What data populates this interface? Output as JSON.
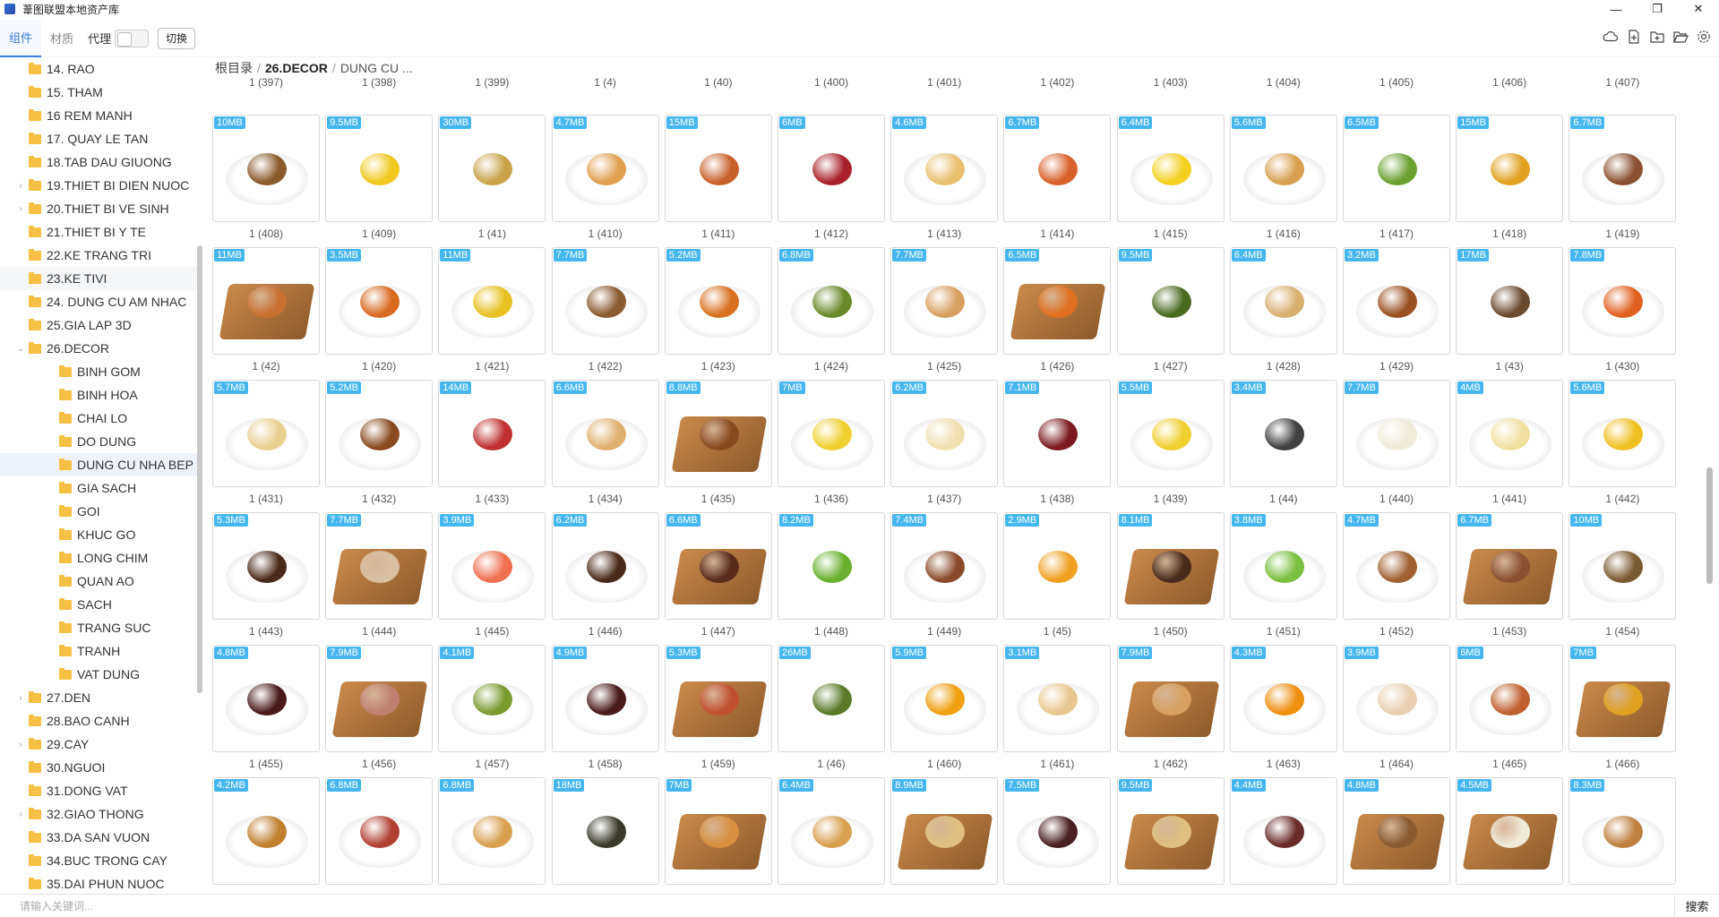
{
  "window": {
    "title": "葦图联盟本地资产库",
    "controls": [
      "—",
      "❐",
      "✕"
    ]
  },
  "toolbar": {
    "tabs": [
      {
        "label": "组件",
        "active": true
      },
      {
        "label": "材质",
        "active": false
      }
    ],
    "proxy_label": "代理",
    "switch_label": "切换",
    "icons": [
      "cloud-icon",
      "new-file-icon",
      "new-folder-icon",
      "open-folder-icon",
      "gear-icon"
    ]
  },
  "breadcrumb": {
    "root": "根目录",
    "folder": "26.DECOR",
    "current": "DUNG CU ..."
  },
  "sidebar": {
    "items": [
      {
        "label": "14. RAO",
        "indent": 0,
        "arrow": ""
      },
      {
        "label": "15. THAM",
        "indent": 0,
        "arrow": ""
      },
      {
        "label": "16 REM MANH",
        "indent": 0,
        "arrow": ""
      },
      {
        "label": "17. QUAY LE TAN",
        "indent": 0,
        "arrow": ""
      },
      {
        "label": "18.TAB DAU GIUONG",
        "indent": 0,
        "arrow": ""
      },
      {
        "label": "19.THIET BI DIEN NUOC",
        "indent": 0,
        "arrow": "›"
      },
      {
        "label": "20.THIET BI VE SINH",
        "indent": 0,
        "arrow": "›"
      },
      {
        "label": "21.THIET BI Y TE",
        "indent": 0,
        "arrow": ""
      },
      {
        "label": "22.KE TRANG TRI",
        "indent": 0,
        "arrow": ""
      },
      {
        "label": "23.KE TIVI",
        "indent": 0,
        "arrow": ""
      },
      {
        "label": "24. DUNG CU AM NHAC",
        "indent": 0,
        "arrow": ""
      },
      {
        "label": "25.GIA LAP 3D",
        "indent": 0,
        "arrow": ""
      },
      {
        "label": "26.DECOR",
        "indent": 0,
        "arrow": "⌄"
      },
      {
        "label": "BINH GOM",
        "indent": 1,
        "arrow": ""
      },
      {
        "label": "BINH HOA",
        "indent": 1,
        "arrow": ""
      },
      {
        "label": "CHAI LO",
        "indent": 1,
        "arrow": ""
      },
      {
        "label": "DO DUNG",
        "indent": 1,
        "arrow": ""
      },
      {
        "label": "DUNG CU NHA BEP",
        "indent": 1,
        "arrow": ""
      },
      {
        "label": "GIA SACH",
        "indent": 1,
        "arrow": ""
      },
      {
        "label": "GOI",
        "indent": 1,
        "arrow": ""
      },
      {
        "label": "KHUC GO",
        "indent": 1,
        "arrow": ""
      },
      {
        "label": "LONG CHIM",
        "indent": 1,
        "arrow": ""
      },
      {
        "label": "QUAN AO",
        "indent": 1,
        "arrow": ""
      },
      {
        "label": "SACH",
        "indent": 1,
        "arrow": ""
      },
      {
        "label": "TRANG SUC",
        "indent": 1,
        "arrow": ""
      },
      {
        "label": "TRANH",
        "indent": 1,
        "arrow": ""
      },
      {
        "label": "VAT DUNG",
        "indent": 1,
        "arrow": ""
      },
      {
        "label": "27.DEN",
        "indent": 0,
        "arrow": "›"
      },
      {
        "label": "28.BAO CANH",
        "indent": 0,
        "arrow": ""
      },
      {
        "label": "29.CAY",
        "indent": 0,
        "arrow": "›"
      },
      {
        "label": "30.NGUOI",
        "indent": 0,
        "arrow": ""
      },
      {
        "label": "31.DONG VAT",
        "indent": 0,
        "arrow": ""
      },
      {
        "label": "32.GIAO THONG",
        "indent": 0,
        "arrow": "›"
      },
      {
        "label": "33.DA SAN VUON",
        "indent": 0,
        "arrow": ""
      },
      {
        "label": "34.BUC TRONG CAY",
        "indent": 0,
        "arrow": ""
      },
      {
        "label": "35.DAI PHUN NUOC",
        "indent": 0,
        "arrow": ""
      }
    ],
    "selected": "DUNG CU NHA BEP",
    "hovered": "23.KE TIVI"
  },
  "assets_top_partial": [
    "1 (397)",
    "1 (398)",
    "1 (399)",
    "1 (4)",
    "1 (40)",
    "1 (400)",
    "1 (401)",
    "1 (402)",
    "1 (403)",
    "1 (404)",
    "1 (405)",
    "1 (406)",
    "1 (407)"
  ],
  "assets": [
    [
      {
        "size": "10MB",
        "name": "1 (408)",
        "style": "plate",
        "color": "#8b5a2b"
      },
      {
        "size": "9.5MB",
        "name": "1 (409)",
        "style": "none",
        "color": "#f0c81e"
      },
      {
        "size": "30MB",
        "name": "1 (41)",
        "style": "none",
        "color": "#c9a24a"
      },
      {
        "size": "4.7MB",
        "name": "1 (410)",
        "style": "plate",
        "color": "#e0a050"
      },
      {
        "size": "15MB",
        "name": "1 (411)",
        "style": "none",
        "color": "#c8602a"
      },
      {
        "size": "6MB",
        "name": "1 (412)",
        "style": "none",
        "color": "#a8202a"
      },
      {
        "size": "4.6MB",
        "name": "1 (413)",
        "style": "plate",
        "color": "#e8c070"
      },
      {
        "size": "6.7MB",
        "name": "1 (414)",
        "style": "none",
        "color": "#d8602a"
      },
      {
        "size": "6.4MB",
        "name": "1 (415)",
        "style": "plate",
        "color": "#f5d020"
      },
      {
        "size": "5.6MB",
        "name": "1 (416)",
        "style": "plate",
        "color": "#d8a050"
      },
      {
        "size": "6.5MB",
        "name": "1 (417)",
        "style": "none",
        "color": "#6aa030"
      },
      {
        "size": "15MB",
        "name": "1 (418)",
        "style": "none",
        "color": "#e0a020"
      },
      {
        "size": "6.7MB",
        "name": "1 (419)",
        "style": "plate",
        "color": "#8a5030"
      }
    ],
    [
      {
        "size": "11MB",
        "name": "1 (42)",
        "style": "board",
        "color": "#c87030"
      },
      {
        "size": "3.5MB",
        "name": "1 (420)",
        "style": "plate",
        "color": "#d86a20"
      },
      {
        "size": "11MB",
        "name": "1 (421)",
        "style": "plate",
        "color": "#e8c020"
      },
      {
        "size": "7.7MB",
        "name": "1 (422)",
        "style": "plate",
        "color": "#8a5a30"
      },
      {
        "size": "5.2MB",
        "name": "1 (423)",
        "style": "plate",
        "color": "#d87020"
      },
      {
        "size": "6.8MB",
        "name": "1 (424)",
        "style": "plate",
        "color": "#6a8a2a"
      },
      {
        "size": "7.7MB",
        "name": "1 (425)",
        "style": "plate",
        "color": "#d8a060"
      },
      {
        "size": "6.5MB",
        "name": "1 (426)",
        "style": "board",
        "color": "#e07020"
      },
      {
        "size": "9.5MB",
        "name": "1 (427)",
        "style": "none",
        "color": "#4a6a20"
      },
      {
        "size": "6.4MB",
        "name": "1 (428)",
        "style": "plate",
        "color": "#d8b070"
      },
      {
        "size": "3.2MB",
        "name": "1 (429)",
        "style": "plate",
        "color": "#9a5020"
      },
      {
        "size": "17MB",
        "name": "1 (43)",
        "style": "none",
        "color": "#6a4a30"
      },
      {
        "size": "7.8MB",
        "name": "1 (430)",
        "style": "plate",
        "color": "#e06020"
      }
    ],
    [
      {
        "size": "5.7MB",
        "name": "1 (431)",
        "style": "plate",
        "color": "#e8d090"
      },
      {
        "size": "5.2MB",
        "name": "1 (432)",
        "style": "plate",
        "color": "#8a4a20"
      },
      {
        "size": "14MB",
        "name": "1 (433)",
        "style": "none",
        "color": "#c03030"
      },
      {
        "size": "6.6MB",
        "name": "1 (434)",
        "style": "plate",
        "color": "#e0b070"
      },
      {
        "size": "8.8MB",
        "name": "1 (435)",
        "style": "board",
        "color": "#8a4a20"
      },
      {
        "size": "7MB",
        "name": "1 (436)",
        "style": "plate",
        "color": "#f0d030"
      },
      {
        "size": "6.2MB",
        "name": "1 (437)",
        "style": "plate",
        "color": "#f0e0b0"
      },
      {
        "size": "7.1MB",
        "name": "1 (438)",
        "style": "none",
        "color": "#7a1a20"
      },
      {
        "size": "5.5MB",
        "name": "1 (439)",
        "style": "plate",
        "color": "#f0d030"
      },
      {
        "size": "3.4MB",
        "name": "1 (44)",
        "style": "none",
        "color": "#404040"
      },
      {
        "size": "7.7MB",
        "name": "1 (440)",
        "style": "plate",
        "color": "#f0ead8"
      },
      {
        "size": "4MB",
        "name": "1 (441)",
        "style": "plate",
        "color": "#f0e0a0"
      },
      {
        "size": "5.6MB",
        "name": "1 (442)",
        "style": "plate",
        "color": "#f0c020"
      }
    ],
    [
      {
        "size": "5.3MB",
        "name": "1 (443)",
        "style": "plate",
        "color": "#4a2a1a"
      },
      {
        "size": "7.7MB",
        "name": "1 (444)",
        "style": "board",
        "color": "#d8c0a0"
      },
      {
        "size": "3.9MB",
        "name": "1 (445)",
        "style": "plate",
        "color": "#f07050"
      },
      {
        "size": "6.2MB",
        "name": "1 (446)",
        "style": "plate",
        "color": "#4a2a1a"
      },
      {
        "size": "6.6MB",
        "name": "1 (447)",
        "style": "board",
        "color": "#5a2a1a"
      },
      {
        "size": "8.2MB",
        "name": "1 (448)",
        "style": "none",
        "color": "#6ab030"
      },
      {
        "size": "7.4MB",
        "name": "1 (449)",
        "style": "plate",
        "color": "#8a4a2a"
      },
      {
        "size": "2.9MB",
        "name": "1 (45)",
        "style": "none",
        "color": "#f0a020"
      },
      {
        "size": "8.1MB",
        "name": "1 (450)",
        "style": "board",
        "color": "#4a2a1a"
      },
      {
        "size": "3.8MB",
        "name": "1 (451)",
        "style": "plate",
        "color": "#7ac040"
      },
      {
        "size": "4.7MB",
        "name": "1 (452)",
        "style": "plate",
        "color": "#a06030"
      },
      {
        "size": "6.7MB",
        "name": "1 (453)",
        "style": "board",
        "color": "#8a5030"
      },
      {
        "size": "10MB",
        "name": "1 (454)",
        "style": "plate",
        "color": "#7a5a30"
      }
    ],
    [
      {
        "size": "4.8MB",
        "name": "1 (455)",
        "style": "plate",
        "color": "#4a1a1a"
      },
      {
        "size": "7.9MB",
        "name": "1 (456)",
        "style": "board",
        "color": "#c08070"
      },
      {
        "size": "4.1MB",
        "name": "1 (457)",
        "style": "plate",
        "color": "#7a9a30"
      },
      {
        "size": "4.9MB",
        "name": "1 (458)",
        "style": "plate",
        "color": "#4a1a1a"
      },
      {
        "size": "5.3MB",
        "name": "1 (459)",
        "style": "board",
        "color": "#c05030"
      },
      {
        "size": "26MB",
        "name": "1 (46)",
        "style": "none",
        "color": "#5a7a2a"
      },
      {
        "size": "5.9MB",
        "name": "1 (460)",
        "style": "plate",
        "color": "#f0a010"
      },
      {
        "size": "3.1MB",
        "name": "1 (461)",
        "style": "plate",
        "color": "#e8c890"
      },
      {
        "size": "7.9MB",
        "name": "1 (462)",
        "style": "board",
        "color": "#d8a060"
      },
      {
        "size": "4.3MB",
        "name": "1 (463)",
        "style": "plate",
        "color": "#f09010"
      },
      {
        "size": "3.9MB",
        "name": "1 (464)",
        "style": "plate",
        "color": "#e8d0b0"
      },
      {
        "size": "6MB",
        "name": "1 (465)",
        "style": "plate",
        "color": "#c06030"
      },
      {
        "size": "7MB",
        "name": "1 (466)",
        "style": "board",
        "color": "#e0a020"
      }
    ],
    [
      {
        "size": "4.2MB",
        "name": "",
        "style": "plate",
        "color": "#c08030"
      },
      {
        "size": "6.8MB",
        "name": "",
        "style": "plate",
        "color": "#b04030"
      },
      {
        "size": "6.8MB",
        "name": "",
        "style": "plate",
        "color": "#d8a050"
      },
      {
        "size": "18MB",
        "name": "",
        "style": "none",
        "color": "#3a3a2a"
      },
      {
        "size": "7MB",
        "name": "",
        "style": "board",
        "color": "#d89040"
      },
      {
        "size": "6.4MB",
        "name": "",
        "style": "plate",
        "color": "#d8a050"
      },
      {
        "size": "8.9MB",
        "name": "",
        "style": "board",
        "color": "#e0c080"
      },
      {
        "size": "7.5MB",
        "name": "",
        "style": "plate",
        "color": "#4a2020"
      },
      {
        "size": "9.5MB",
        "name": "",
        "style": "board",
        "color": "#e0c080"
      },
      {
        "size": "4.4MB",
        "name": "",
        "style": "plate",
        "color": "#6a2a2a"
      },
      {
        "size": "4.8MB",
        "name": "",
        "style": "board",
        "color": "#8a5a30"
      },
      {
        "size": "4.5MB",
        "name": "",
        "style": "board",
        "color": "#f0ead8"
      },
      {
        "size": "8.3MB",
        "name": "",
        "style": "plate",
        "color": "#c08040"
      }
    ]
  ],
  "search": {
    "placeholder": "请输入关键词...",
    "button_label": "搜索"
  },
  "colors": {
    "accent": "#3a7fe0",
    "badge": "#46b6ef",
    "folder": "#f5c043"
  }
}
